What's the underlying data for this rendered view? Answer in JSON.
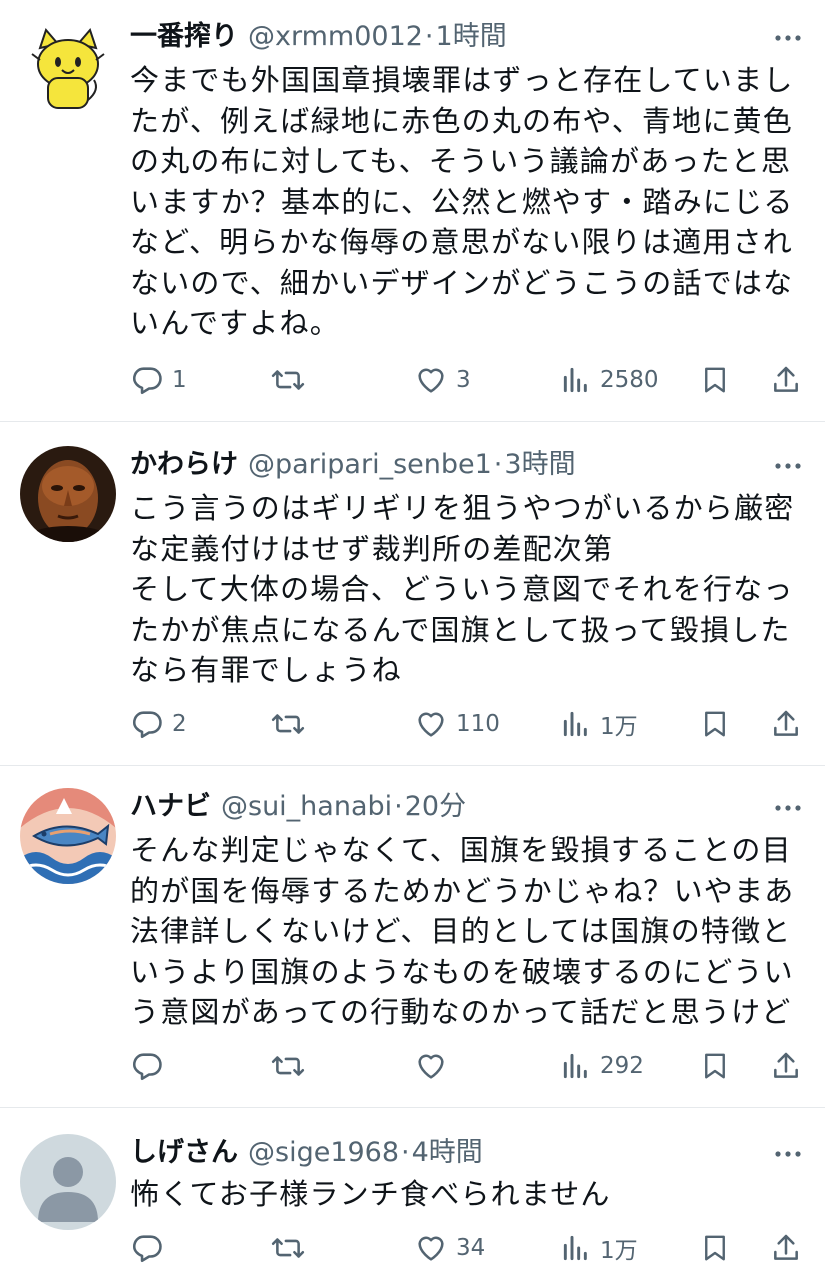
{
  "tweets": [
    {
      "name": "一番搾り",
      "handle": "@xrmm0012",
      "time": "1時間",
      "text": "今までも外国国章損壊罪はずっと存在していまし\nたが、例えば緑地に赤色の丸の布や、青地に黄色\nの丸の布に対しても、そういう議論があったと思\nいますか？基本的に、公然と燃やす・踏みにじる\nなど、明らかな侮辱の意思がない限りは適用され\nないので、細かいデザインがどうこうの話ではな\nいんですよね。",
      "replies": "1",
      "retweets": "",
      "likes": "3",
      "views": "2580",
      "avatar_icon": "yellow-cat-avatar"
    },
    {
      "name": "かわらけ",
      "handle": "@paripari_senbe1",
      "time": "3時間",
      "text": "こう言うのはギリギリを狙うやつがいるから厳密\nな定義付けはせず裁判所の差配次第\nそして大体の場合、どういう意図でそれを行なっ\nたかが焦点になるんで国旗として扱って毀損した\nなら有罪でしょうね",
      "replies": "2",
      "retweets": "",
      "likes": "110",
      "views": "1万",
      "avatar_icon": "face-figure-avatar"
    },
    {
      "name": "ハナビ",
      "handle": "@sui_hanabi",
      "time": "20分",
      "text": "そんな判定じゃなくて、国旗を毀損することの目\n的が国を侮辱するためかどうかじゃね？いやまあ\n法律詳しくないけど、目的としては国旗の特徴と\nいうより国旗のようなものを破壊するのにどうい\nう意図があっての行動なのかって話だと思うけど",
      "replies": "",
      "retweets": "",
      "likes": "",
      "views": "292",
      "avatar_icon": "fish-wave-avatar"
    },
    {
      "name": "しげさん",
      "handle": "@sige1968",
      "time": "4時間",
      "text": "怖くてお子様ランチ食べられません",
      "replies": "",
      "retweets": "",
      "likes": "34",
      "views": "1万",
      "avatar_icon": "default-profile-avatar"
    }
  ],
  "separator": "·",
  "colors": {
    "text": "#0f1419",
    "secondary": "#536471",
    "divider": "#e6e9ec"
  }
}
